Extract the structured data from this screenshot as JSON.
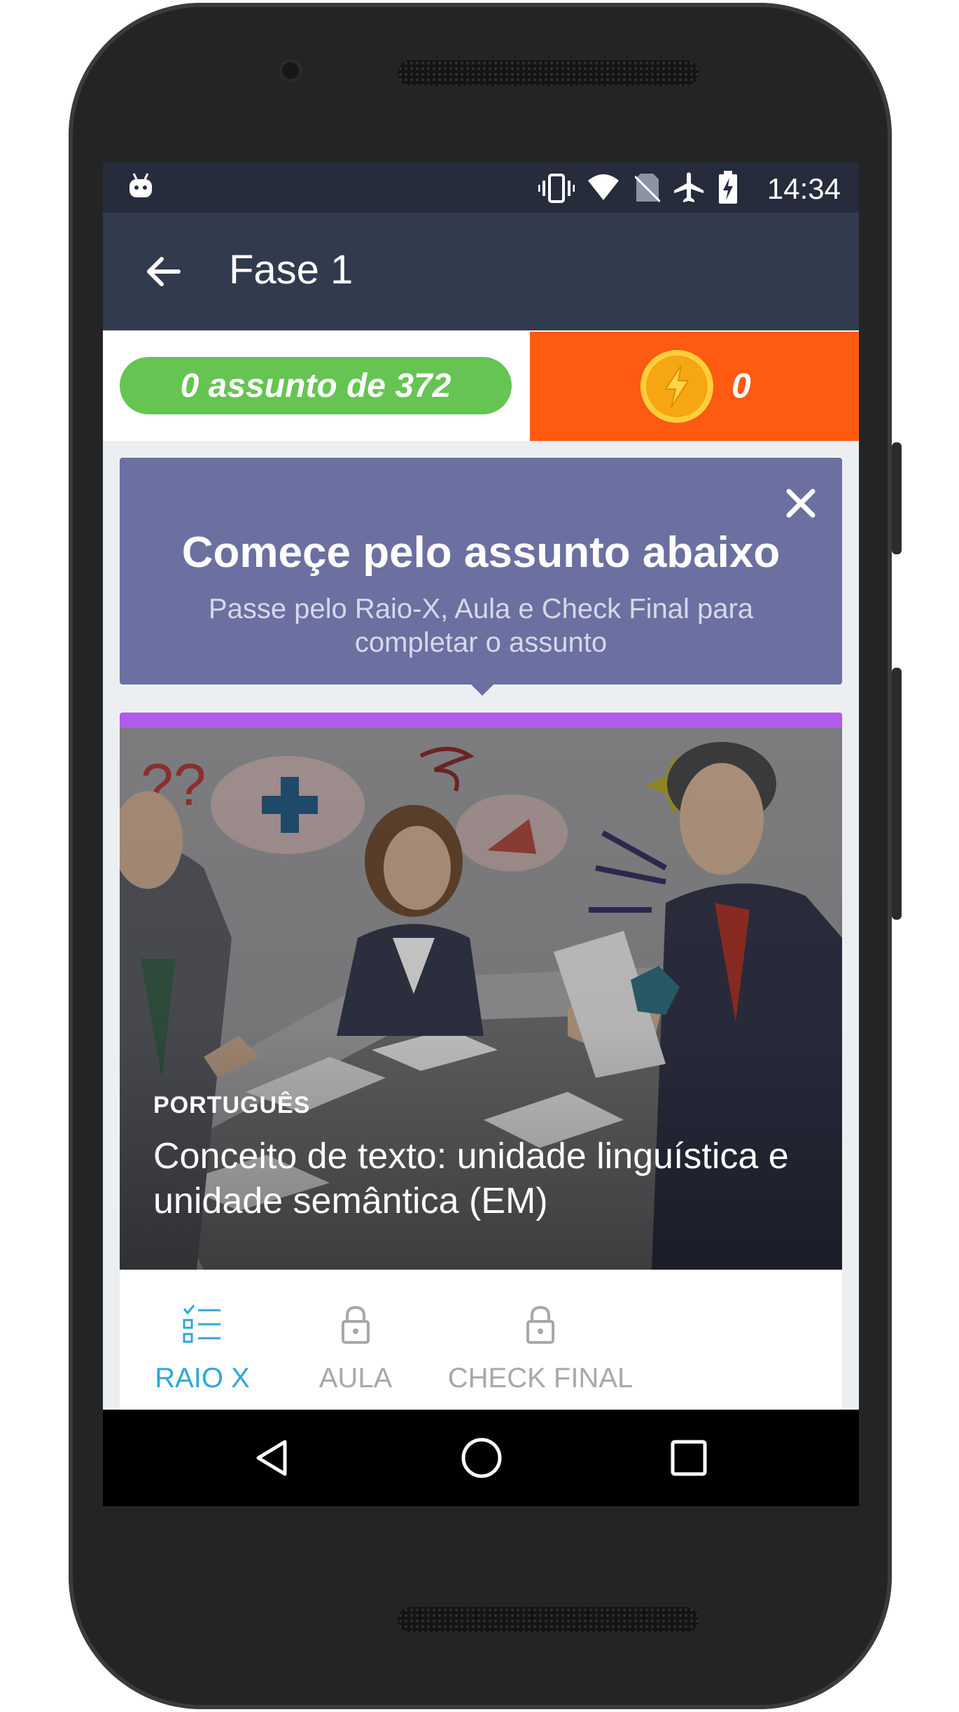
{
  "status": {
    "time": "14:34"
  },
  "appbar": {
    "title": "Fase 1"
  },
  "progress": {
    "label": "0 assunto de 372"
  },
  "coins": {
    "count": "0"
  },
  "tip": {
    "title": "Começe pelo assunto abaixo",
    "subtitle": "Passe pelo Raio-X, Aula e Check Final para completar o assunto"
  },
  "card": {
    "subject": "PORTUGUÊS",
    "title": "Conceito de texto: unidade linguística e unidade semântica (EM)"
  },
  "steps": [
    {
      "label": "RAIO X",
      "icon": "checklist-icon",
      "state": "active"
    },
    {
      "label": "AULA",
      "icon": "lock-icon",
      "state": "locked"
    },
    {
      "label": "CHECK FINAL",
      "icon": "lock-icon",
      "state": "locked"
    }
  ],
  "colors": {
    "appbar": "#323a4e",
    "progress_green": "#65c452",
    "coins_orange": "#ff5a12",
    "tip_purple": "#6b70a1",
    "card_accent": "#b15bea",
    "active_blue": "#2ea6df"
  }
}
